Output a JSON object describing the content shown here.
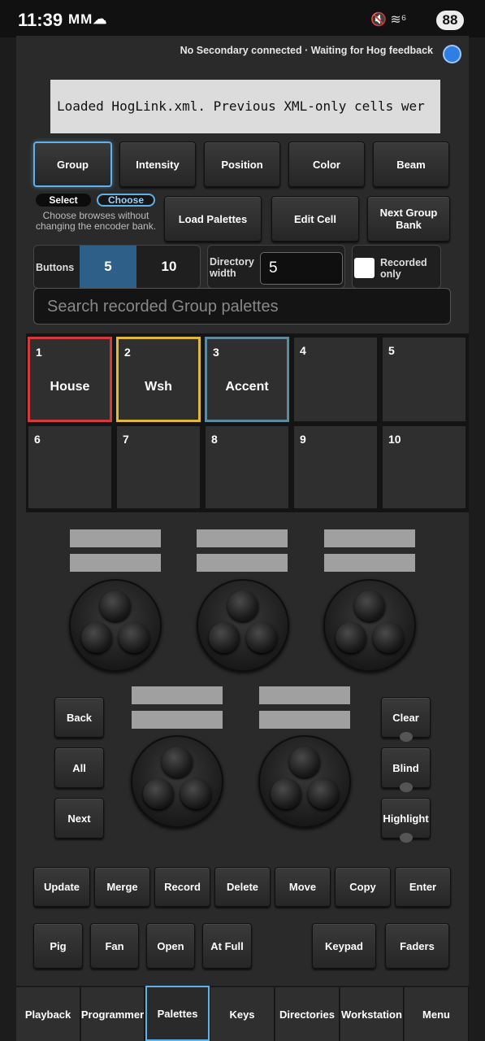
{
  "status_bar": {
    "time": "11:39",
    "app_icons": "MM☁",
    "right_icons": "🔇 ≋⁶",
    "battery": "88"
  },
  "connection_status": "No Secondary connected · Waiting for Hog feedback",
  "message": "Loaded HogLink.xml. Previous XML-only cells wer",
  "palette_tabs": [
    "Group",
    "Intensity",
    "Position",
    "Color",
    "Beam"
  ],
  "mode": {
    "select": "Select",
    "choose": "Choose",
    "note": "Choose browses without changing the encoder bank."
  },
  "actions": {
    "load_palettes": "Load Palettes",
    "edit_cell": "Edit Cell",
    "next_group_bank": "Next Group Bank"
  },
  "buttons_setting": {
    "label": "Buttons",
    "option_5": "5",
    "option_10": "10",
    "selected": "5"
  },
  "directory_width": {
    "label": "Directory width",
    "value": "5"
  },
  "recorded_only": {
    "label": "Recorded only",
    "checked": false
  },
  "search": {
    "placeholder": "Search recorded Group palettes"
  },
  "grid": {
    "cells": [
      {
        "num": "1",
        "name": "House",
        "color": "#d23b3b"
      },
      {
        "num": "2",
        "name": "Wsh",
        "color": "#e0b93a"
      },
      {
        "num": "3",
        "name": "Accent",
        "color": "#5e8aa0"
      },
      {
        "num": "4",
        "name": "",
        "color": ""
      },
      {
        "num": "5",
        "name": "",
        "color": ""
      },
      {
        "num": "6",
        "name": "",
        "color": ""
      },
      {
        "num": "7",
        "name": "",
        "color": ""
      },
      {
        "num": "8",
        "name": "",
        "color": ""
      },
      {
        "num": "9",
        "name": "",
        "color": ""
      },
      {
        "num": "10",
        "name": "",
        "color": ""
      }
    ]
  },
  "nav_left": [
    "Back",
    "All",
    "Next"
  ],
  "nav_right": [
    "Clear",
    "Blind",
    "Highlight"
  ],
  "function_row": [
    "Update",
    "Merge",
    "Record",
    "Delete",
    "Move",
    "Copy",
    "Enter"
  ],
  "bottom_row": {
    "pig": "Pig",
    "fan": "Fan",
    "open": "Open",
    "at_full": "At Full",
    "keypad": "Keypad",
    "faders": "Faders"
  },
  "tabs": [
    "Playback",
    "Programmer",
    "Palettes",
    "Keys",
    "Directories",
    "Workstation",
    "Menu"
  ],
  "selected_tab": "Palettes",
  "accent_color": "#5fb1ea"
}
